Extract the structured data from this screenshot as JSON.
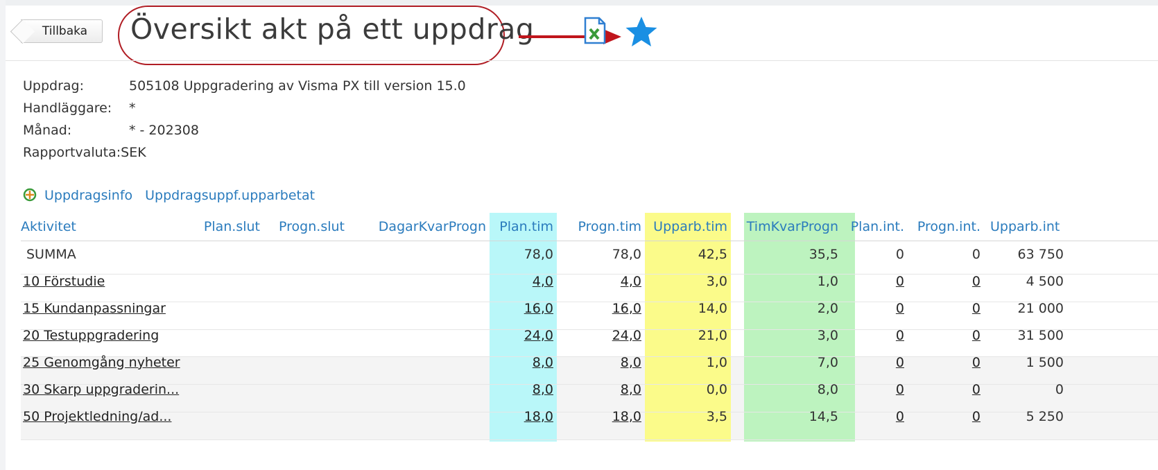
{
  "header": {
    "back_label": "Tillbaka",
    "title": "Översikt akt på ett uppdrag"
  },
  "icons": {
    "export": "excel-export-icon",
    "favorite": "star-icon",
    "favorite_color": "#1a8fe3",
    "annotation_color": "#c0151c"
  },
  "info": [
    {
      "label": "Uppdrag:",
      "value": "505108 Uppgradering av Visma PX till version 15.0"
    },
    {
      "label": "Handläggare:",
      "value": "*"
    },
    {
      "label": "Månad:",
      "value": "* - 202308"
    },
    {
      "label": "Rapportvaluta:",
      "value": "SEK"
    }
  ],
  "links": {
    "info_label": "Uppdragsinfo",
    "followup_label": "Uppdragsuppf.upparbetat"
  },
  "table": {
    "columns": [
      "Aktivitet",
      "Plan.slut",
      "Progn.slut",
      "DagarKvarProgn",
      "Plan.tim",
      "Progn.tim",
      "Upparb.tim",
      "TimKvarProgn",
      "Plan.int.",
      "Progn.int.",
      "Upparb.int"
    ],
    "highlight_colors": {
      "Plan.tim": "#b9f7f9",
      "Upparb.tim": "#fbfb8a",
      "TimKvarProgn": "#bdf3bf"
    },
    "rows": [
      {
        "aktivitet": "SUMMA",
        "plan_slut": "",
        "progn_slut": "",
        "dagar": "",
        "plan_tim": "78,0",
        "progn_tim": "78,0",
        "upparb_tim": "42,5",
        "timkvar": "35,5",
        "plan_int": "0",
        "progn_int": "0",
        "upparb_int": "63 750"
      },
      {
        "aktivitet": "10 Förstudie",
        "plan_slut": "",
        "progn_slut": "",
        "dagar": "",
        "plan_tim": "4,0",
        "progn_tim": "4,0",
        "upparb_tim": "3,0",
        "timkvar": "1,0",
        "plan_int": "0",
        "progn_int": "0",
        "upparb_int": "4 500"
      },
      {
        "aktivitet": "15 Kundanpassningar",
        "plan_slut": "",
        "progn_slut": "",
        "dagar": "",
        "plan_tim": "16,0",
        "progn_tim": "16,0",
        "upparb_tim": "14,0",
        "timkvar": "2,0",
        "plan_int": "0",
        "progn_int": "0",
        "upparb_int": "21 000"
      },
      {
        "aktivitet": "20 Testuppgradering",
        "plan_slut": "",
        "progn_slut": "",
        "dagar": "",
        "plan_tim": "24,0",
        "progn_tim": "24,0",
        "upparb_tim": "21,0",
        "timkvar": "3,0",
        "plan_int": "0",
        "progn_int": "0",
        "upparb_int": "31 500"
      },
      {
        "aktivitet": "25 Genomgång nyheter",
        "plan_slut": "",
        "progn_slut": "",
        "dagar": "",
        "plan_tim": "8,0",
        "progn_tim": "8,0",
        "upparb_tim": "1,0",
        "timkvar": "7,0",
        "plan_int": "0",
        "progn_int": "0",
        "upparb_int": "1 500"
      },
      {
        "aktivitet": "30 Skarp uppgraderin...",
        "plan_slut": "",
        "progn_slut": "",
        "dagar": "",
        "plan_tim": "8,0",
        "progn_tim": "8,0",
        "upparb_tim": "0,0",
        "timkvar": "8,0",
        "plan_int": "0",
        "progn_int": "0",
        "upparb_int": "0"
      },
      {
        "aktivitet": "50 Projektledning/ad...",
        "plan_slut": "",
        "progn_slut": "",
        "dagar": "",
        "plan_tim": "18,0",
        "progn_tim": "18,0",
        "upparb_tim": "3,5",
        "timkvar": "14,5",
        "plan_int": "0",
        "progn_int": "0",
        "upparb_int": "5 250"
      }
    ]
  }
}
